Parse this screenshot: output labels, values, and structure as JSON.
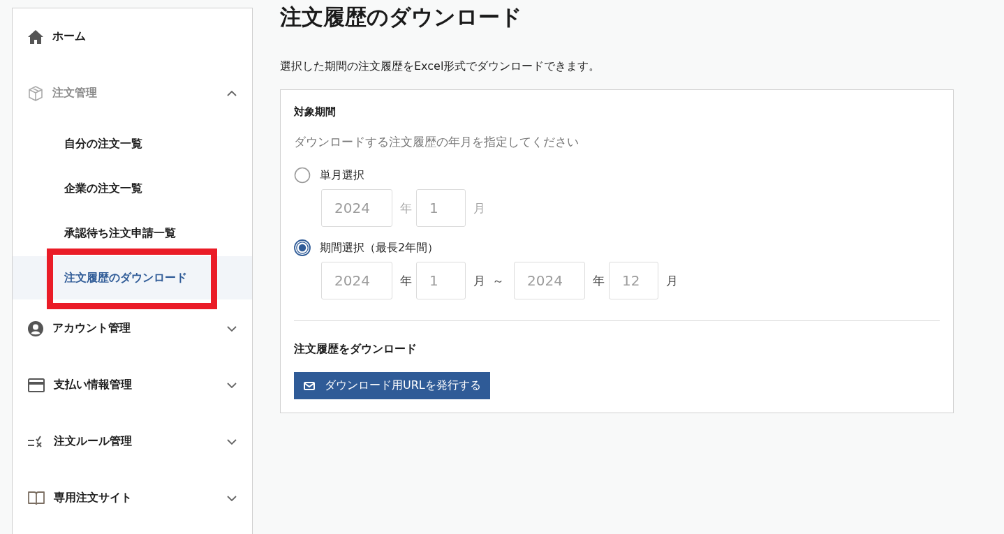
{
  "sidebar": {
    "items": [
      {
        "kind": "link",
        "label": "ホーム"
      },
      {
        "kind": "group",
        "label": "注文管理",
        "expanded": true,
        "children": [
          {
            "label": "自分の注文一覧",
            "selected": false,
            "highlighted": false
          },
          {
            "label": "企業の注文一覧",
            "selected": false,
            "highlighted": false
          },
          {
            "label": "承認待ち注文申請一覧",
            "selected": false,
            "highlighted": false
          },
          {
            "label": "注文履歴のダウンロード",
            "selected": true,
            "highlighted": true
          }
        ]
      },
      {
        "kind": "group",
        "label": "アカウント管理",
        "expanded": false
      },
      {
        "kind": "group",
        "label": "支払い情報管理",
        "expanded": false
      },
      {
        "kind": "group",
        "label": "注文ルール管理",
        "expanded": false
      },
      {
        "kind": "group",
        "label": "専用注文サイト",
        "expanded": false
      }
    ]
  },
  "main": {
    "title": "注文履歴のダウンロード",
    "description": "選択した期間の注文履歴をExcel形式でダウンロードできます。",
    "period_card": {
      "heading": "対象期間",
      "hint": "ダウンロードする注文履歴の年月を指定してください",
      "options": [
        {
          "label": "単月選択",
          "selected": false,
          "fields": [
            {
              "placeholder": "2024",
              "unit": "年"
            },
            {
              "placeholder": "1",
              "unit": "月"
            }
          ]
        },
        {
          "label": "期間選択（最長2年間）",
          "selected": true,
          "fields": [
            {
              "placeholder": "2024",
              "unit": "年"
            },
            {
              "placeholder": "1",
              "unit": "月",
              "separator": "～"
            },
            {
              "placeholder": "2024",
              "unit": "年"
            },
            {
              "placeholder": "12",
              "unit": "月"
            }
          ]
        }
      ]
    },
    "download": {
      "heading": "注文履歴をダウンロード",
      "button": "ダウンロード用URLを発行する"
    }
  }
}
